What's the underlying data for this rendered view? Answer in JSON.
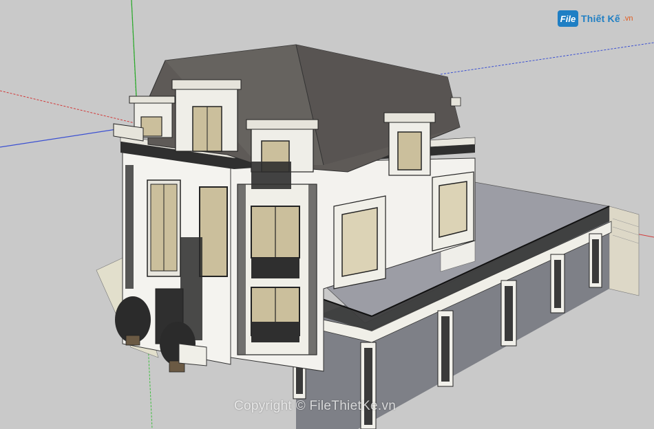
{
  "watermark": {
    "text": "Copyright © FileThietKe.vn"
  },
  "logo": {
    "mark": "File",
    "name": "Thiết Kế",
    "tld": ".vn"
  },
  "colors": {
    "background": "#c8c8c8",
    "axis_red": "#d23a3a",
    "axis_green": "#3bbf3b",
    "axis_blue": "#3a4fd2",
    "roof": "#5e5a57",
    "wall": "#f3f2ee",
    "trim": "#2a2a2a",
    "glass": "#cfc3a0",
    "terrace": "#9a9ba3",
    "garage_floor": "#7d7f86"
  }
}
